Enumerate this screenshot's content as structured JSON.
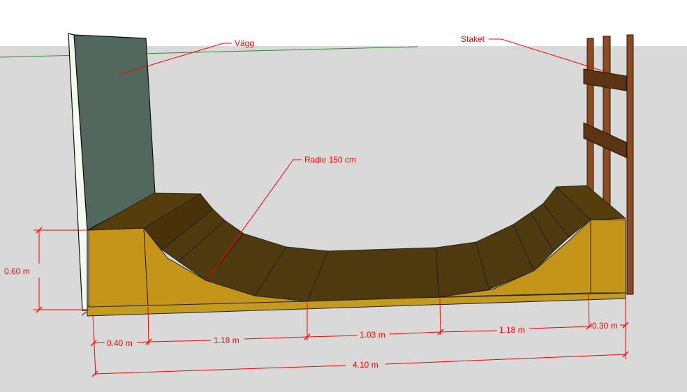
{
  "labels": {
    "wall": "Vägg",
    "fence": "Staket",
    "radius": "Radie 150 cm"
  },
  "dimensions": {
    "height": "0.60 m",
    "deck_left": "0.40 m",
    "transition_left": "1.18 m",
    "flat_bottom": "1.03 m",
    "transition_right": "1.18 m",
    "deck_right": "0.30 m",
    "total_length": "4.10 m"
  },
  "colors": {
    "sky": "#ffffff",
    "ground": "#d9d9d9",
    "wall": "#52685e",
    "ramp_side": "#c5951a",
    "ramp_surface": "#4f3a10",
    "fence_wood": "#8b4a22",
    "annotation": "#ff0000",
    "horizon": "#2e8b2e"
  }
}
